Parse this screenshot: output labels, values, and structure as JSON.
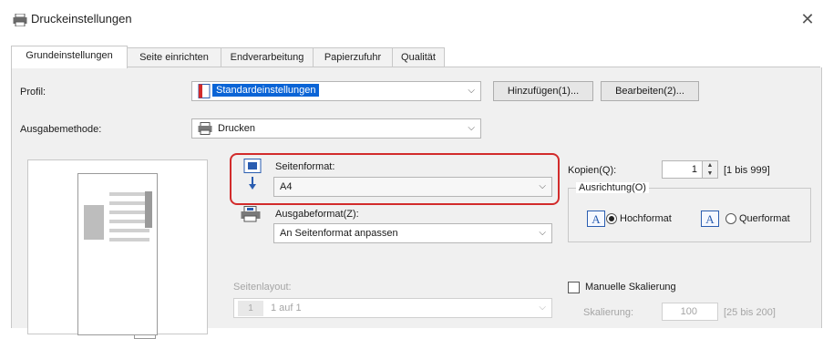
{
  "window": {
    "title": "Druckeinstellungen",
    "close_glyph": "✕"
  },
  "tabs": [
    {
      "label": "Grundeinstellungen",
      "active": true
    },
    {
      "label": "Seite einrichten",
      "active": false
    },
    {
      "label": "Endverarbeitung",
      "active": false
    },
    {
      "label": "Papierzufuhr",
      "active": false
    },
    {
      "label": "Qualität",
      "active": false
    }
  ],
  "profile": {
    "label": "Profil:",
    "value": "Standardeinstellungen",
    "add_button": "Hinzufügen(1)...",
    "edit_button": "Bearbeiten(2)..."
  },
  "output_method": {
    "label": "Ausgabemethode:",
    "value": "Drucken"
  },
  "page_size": {
    "label": "Seitenformat:",
    "value": "A4"
  },
  "output_size": {
    "label": "Ausgabeformat(Z):",
    "value": "An Seitenformat anpassen"
  },
  "copies": {
    "label": "Kopien(Q):",
    "value": "1",
    "range": "[1 bis 999]"
  },
  "orientation": {
    "label": "Ausrichtung(O)",
    "portrait": "Hochformat",
    "landscape": "Querformat",
    "selected": "portrait"
  },
  "page_layout": {
    "label": "Seitenlayout:",
    "value": "1 auf 1"
  },
  "manual_scaling": {
    "label": "Manuelle Skalierung",
    "checked": false
  },
  "scaling": {
    "label": "Skalierung:",
    "value": "100",
    "range": "[25 bis 200]"
  },
  "icons": {
    "app": "printer-icon",
    "output_method": "printer-icon",
    "page_size": "page-size-icon",
    "output_size": "output-size-icon",
    "orientation": "letter-a-icon"
  },
  "colors": {
    "highlight": "#d22b2b",
    "selection": "#0a64d6"
  }
}
